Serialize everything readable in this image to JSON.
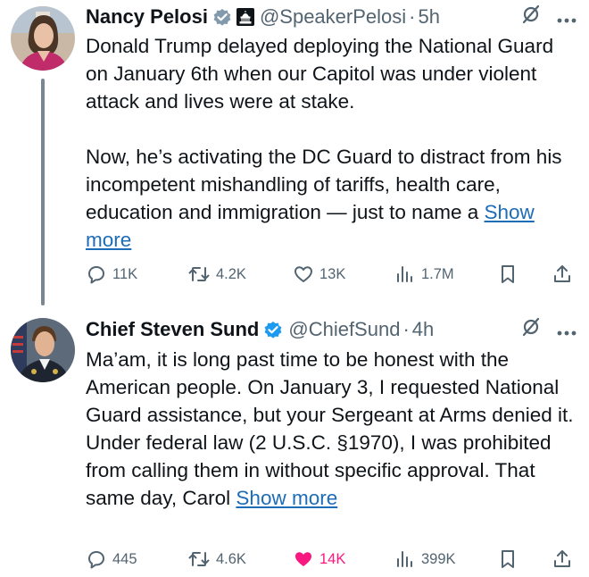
{
  "tweets": [
    {
      "author_name": "Nancy Pelosi",
      "handle": "@SpeakerPelosi",
      "separator": "·",
      "time": "5h",
      "badges": [
        "verified-badge-gray",
        "capitol-affiliation-badge"
      ],
      "paragraphs": [
        "Donald Trump delayed deploying the National Guard on January 6th when our Capitol was under violent attack and lives were at stake.",
        "Now, he’s activating the DC Guard to distract from his incompetent mishandling of tariffs, health care, education and immigration — just to name a"
      ],
      "show_more": "Show more",
      "actions": {
        "replies": "11K",
        "reposts": "4.2K",
        "likes": "13K",
        "views": "1.7M"
      }
    },
    {
      "author_name": "Chief Steven Sund",
      "handle": "@ChiefSund",
      "separator": "·",
      "time": "4h",
      "badges": [
        "verified-badge-blue"
      ],
      "paragraphs": [
        "Ma’am, it is long past time to be honest with the American people. On January 3, I requested National Guard assistance, but your Sergeant at Arms denied it. Under federal law (2 U.S.C. §1970), I was prohibited from calling them in without specific approval. That same day, Carol"
      ],
      "show_more": "Show more",
      "actions": {
        "replies": "445",
        "reposts": "4.6K",
        "likes": "14K",
        "views": "399K"
      },
      "liked": true
    }
  ],
  "colors": {
    "text": "#0f1419",
    "muted": "#536471",
    "link": "#1d6cb7",
    "like_active": "#f91880",
    "verified_blue": "#1d9bf0",
    "verified_gray": "#829aab"
  }
}
